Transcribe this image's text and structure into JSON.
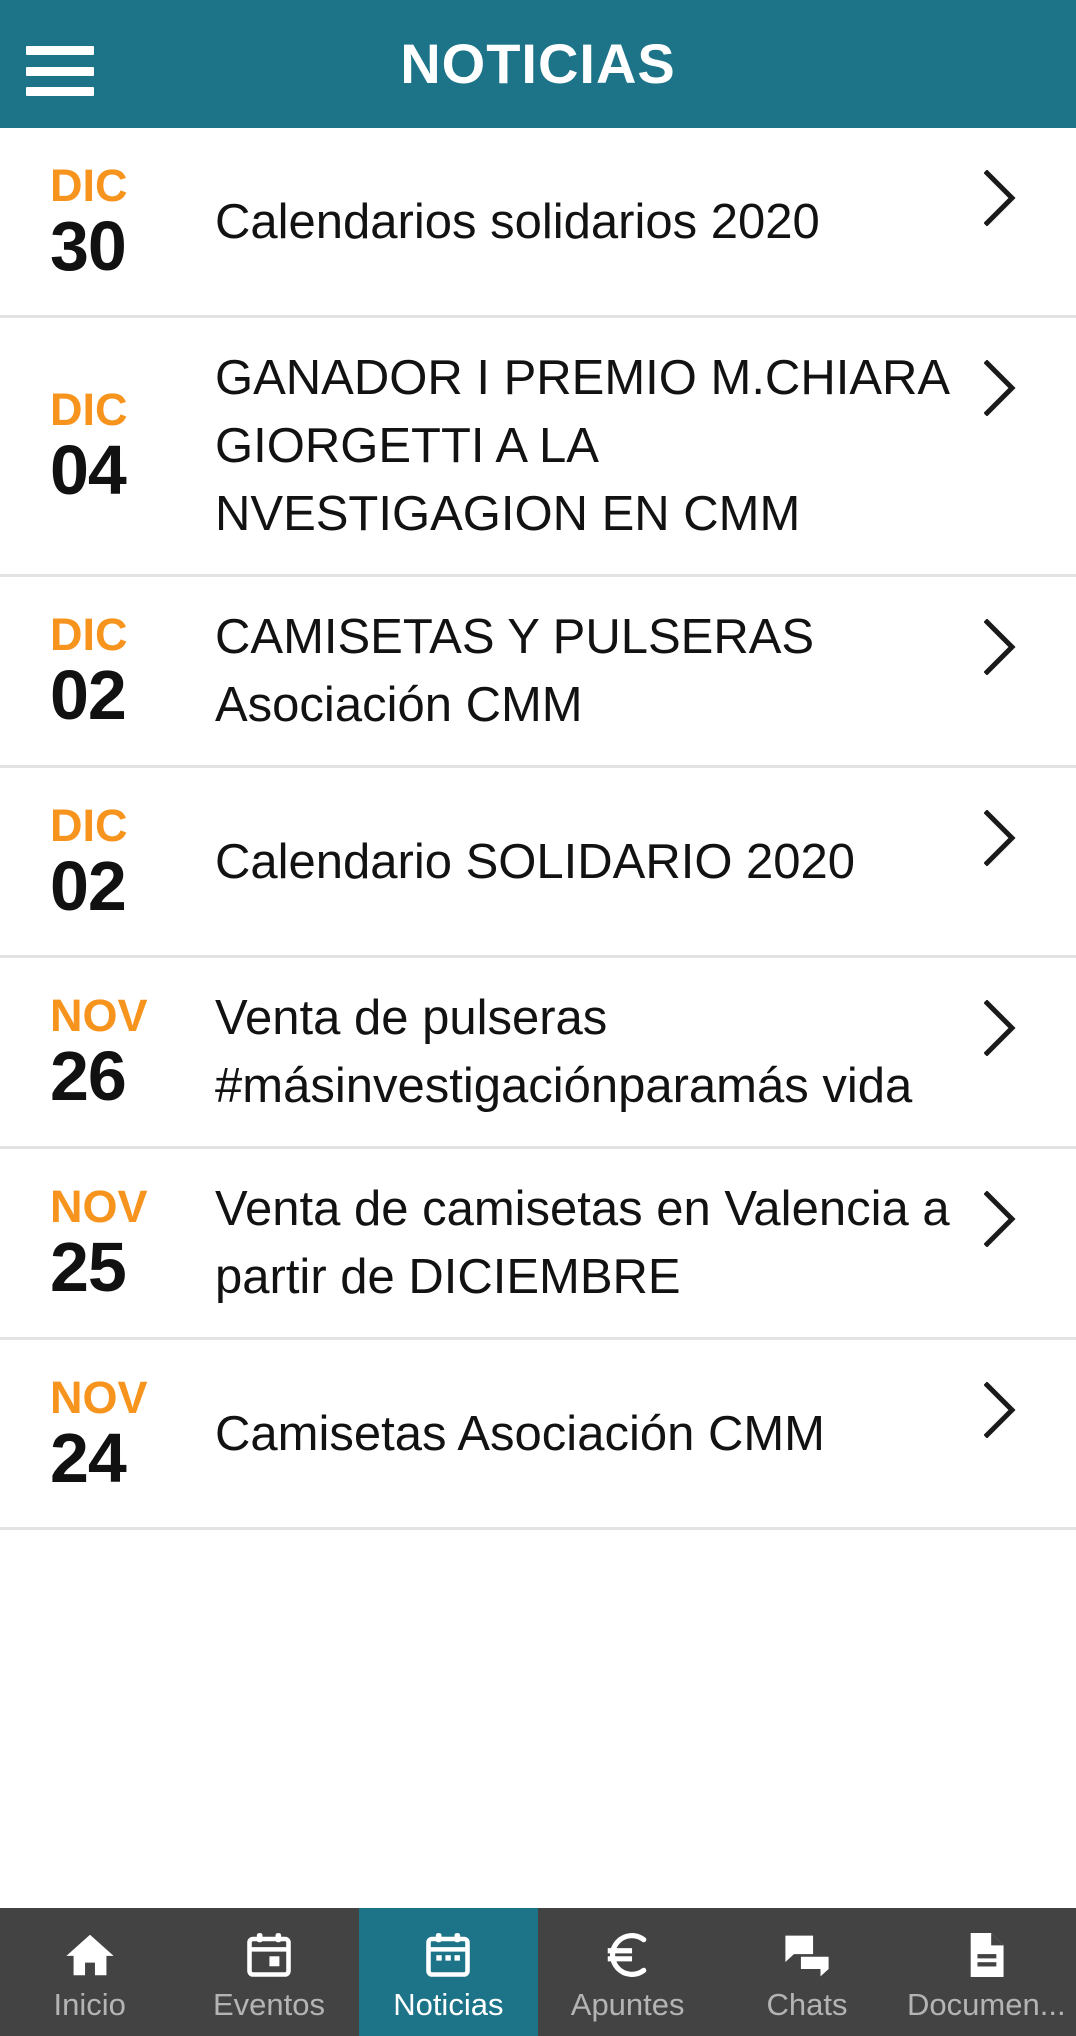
{
  "header": {
    "title": "NOTICIAS",
    "menu_icon": "hamburger-menu-icon",
    "background_color": "#1d7489"
  },
  "theme": {
    "accent_teal": "#1d7489",
    "accent_orange": "#f7941e",
    "nav_background": "#434343",
    "nav_inactive_label": "#b4b4b4",
    "divider": "#e3e3e3"
  },
  "news": {
    "items": [
      {
        "month": "DIC",
        "day": "30",
        "title": "Calendarios solidarios 2020",
        "chevron": "chevron-right-icon"
      },
      {
        "month": "DIC",
        "day": "04",
        "title": "GANADOR I PREMIO M.CHIARA GIORGETTI A LA NVESTIGAGION EN CMM",
        "chevron": "chevron-right-icon"
      },
      {
        "month": "DIC",
        "day": "02",
        "title": "CAMISETAS Y PULSERAS Asociación CMM",
        "chevron": "chevron-right-icon"
      },
      {
        "month": "DIC",
        "day": "02",
        "title": "Calendario SOLIDARIO 2020",
        "chevron": "chevron-right-icon"
      },
      {
        "month": "NOV",
        "day": "26",
        "title": "Venta de pulseras #másinvestigaciónparamás vida",
        "chevron": "chevron-right-icon"
      },
      {
        "month": "NOV",
        "day": "25",
        "title": "Venta de camisetas en Valencia a partir de DICIEMBRE",
        "chevron": "chevron-right-icon"
      },
      {
        "month": "NOV",
        "day": "24",
        "title": "Camisetas Asociación CMM",
        "chevron": "chevron-right-icon"
      }
    ]
  },
  "bottom_nav": {
    "items": [
      {
        "label": "Inicio",
        "icon": "home-icon",
        "active": false
      },
      {
        "label": "Eventos",
        "icon": "calendar-icon",
        "active": false
      },
      {
        "label": "Noticias",
        "icon": "calendar-news-icon",
        "active": true
      },
      {
        "label": "Apuntes",
        "icon": "euro-icon",
        "active": false
      },
      {
        "label": "Chats",
        "icon": "chat-bubbles-icon",
        "active": false
      },
      {
        "label": "Documen...",
        "icon": "document-icon",
        "active": false
      }
    ]
  }
}
